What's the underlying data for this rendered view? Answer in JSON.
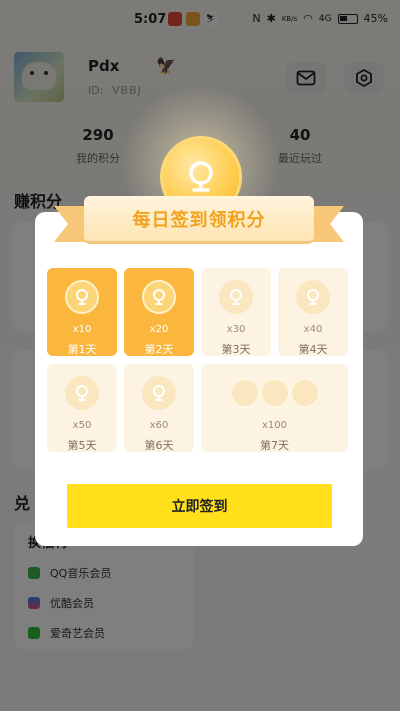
{
  "status_bar": {
    "time": "5:07",
    "network": "4G",
    "speed": "KB/s",
    "battery": "45%"
  },
  "profile": {
    "username": "Pdx",
    "id_label": "ID:",
    "id_value": "VBBJ"
  },
  "stats": {
    "points_value": "290",
    "points_label": "我的积分",
    "recent_value": "40",
    "recent_label": "最近玩过"
  },
  "background": {
    "earn_title": "赚积分",
    "exchange_title": "兑",
    "exchange_card_title": "换福利",
    "exchange_items": [
      "QQ音乐会员",
      "优酷会员",
      "爱奇艺会员"
    ]
  },
  "modal": {
    "title": "每日签到领积分",
    "days": [
      {
        "amount": "x10",
        "label": "第1天",
        "claimed": true
      },
      {
        "amount": "x20",
        "label": "第2天",
        "claimed": true
      },
      {
        "amount": "x30",
        "label": "第3天",
        "claimed": false
      },
      {
        "amount": "x40",
        "label": "第4天",
        "claimed": false
      },
      {
        "amount": "x50",
        "label": "第5天",
        "claimed": false
      },
      {
        "amount": "x60",
        "label": "第6天",
        "claimed": false
      },
      {
        "amount": "x100",
        "label": "第7天",
        "claimed": false
      }
    ],
    "button_label": "立即签到"
  },
  "colors": {
    "claimed": "#fbb63e",
    "unclaimed": "#fdf3e3",
    "button": "#ffe01b",
    "title_text": "#f0a21c"
  }
}
